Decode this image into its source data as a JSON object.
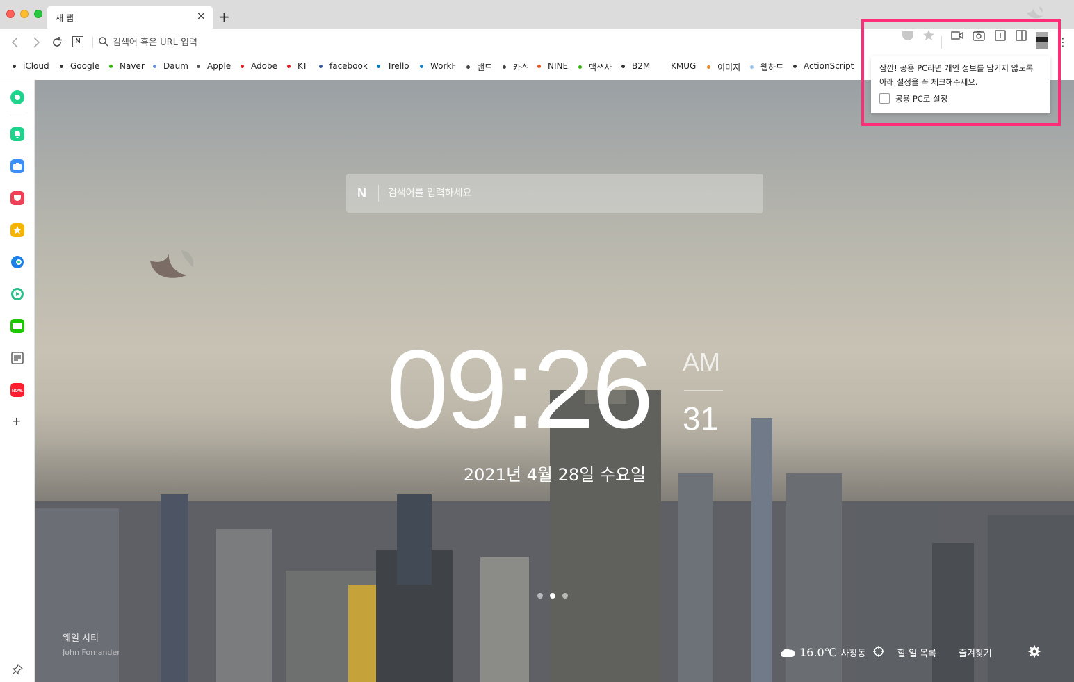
{
  "tab": {
    "title": "새 탭",
    "close": "×",
    "new": "+"
  },
  "toolbar": {
    "url_placeholder": "검색어 혹은 URL 입력",
    "n_label": "N"
  },
  "bookmarks": [
    {
      "label": "iCloud",
      "color": "#333333"
    },
    {
      "label": "Google",
      "color": "#333333"
    },
    {
      "label": "Naver",
      "color": "#2db400"
    },
    {
      "label": "Daum",
      "color": "#6e8fd6"
    },
    {
      "label": "Apple",
      "color": "#555555"
    },
    {
      "label": "Adobe",
      "color": "#e11e26"
    },
    {
      "label": "KT",
      "color": "#e11e26"
    },
    {
      "label": "facebook",
      "color": "#3b5998"
    },
    {
      "label": "Trello",
      "color": "#0079bf"
    },
    {
      "label": "WorkF",
      "color": "#1a7fc2"
    },
    {
      "label": "밴드",
      "color": "#444444"
    },
    {
      "label": "카스",
      "color": "#444444"
    },
    {
      "label": "NINE",
      "color": "#e8501e"
    },
    {
      "label": "맥쓰사",
      "color": "#2db400"
    },
    {
      "label": "B2M",
      "color": "#333333"
    },
    {
      "label": "KMUG",
      "color": "#ffffff"
    },
    {
      "label": "이미지",
      "color": "#f08a24"
    },
    {
      "label": "웹하드",
      "color": "#9cc3ef"
    },
    {
      "label": "ActionScript",
      "color": "#333333"
    }
  ],
  "sidebar": {
    "icons": [
      {
        "name": "whale-space-icon",
        "color": "#1ed48c"
      },
      {
        "name": "notification-icon",
        "color": "#1ed48c"
      },
      {
        "name": "toolbox-icon",
        "color": "#3a8ef6"
      },
      {
        "name": "pocket-icon",
        "color": "#ef4056"
      },
      {
        "name": "favorites-icon",
        "color": "#f5b400"
      },
      {
        "name": "papago-icon",
        "color": "#1a7fe8"
      },
      {
        "name": "music-player-icon",
        "color": "#27c08a"
      },
      {
        "name": "webtoon-icon",
        "color": "#1ec800"
      },
      {
        "name": "memo-icon",
        "color": "#666666"
      },
      {
        "name": "now-icon",
        "color": "#ff1e2d"
      }
    ],
    "add": "+"
  },
  "search": {
    "n_label": "N",
    "placeholder": "검색어를 입력하세요"
  },
  "clock": {
    "time": "09:26",
    "ampm": "AM",
    "seconds": "31",
    "date": "2021년 4월 28일 수요일"
  },
  "credit": {
    "title": "웨일 시티",
    "author": "John Fomander"
  },
  "footer": {
    "temperature": "16.0℃",
    "location": "사창동",
    "todo": "할 일 목록",
    "favorites": "즐겨찾기"
  },
  "popover": {
    "line1": "잠깐! 공용 PC라면 개인 정보를 남기지 않도록",
    "line2": "아래 설정을 꼭 체크해주세요.",
    "checkbox_label": "공용 PC로 설정",
    "checked": false
  },
  "colors": {
    "highlight": "#ff2d78"
  }
}
